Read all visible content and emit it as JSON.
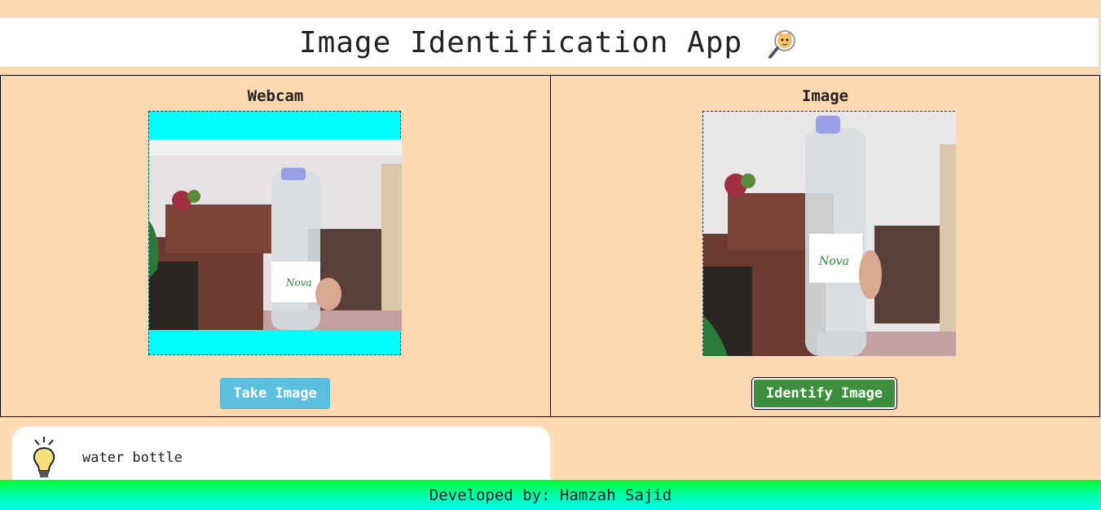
{
  "app": {
    "title": "Image Identification App",
    "title_icon": "cat-magnifying-glass-icon"
  },
  "webcam_panel": {
    "heading": "Webcam",
    "button_label": "Take Image",
    "button_color": "#5bc0de",
    "frame_color": "#00ffff"
  },
  "image_panel": {
    "heading": "Image",
    "button_label": "Identify Image",
    "button_color": "#3c8f3c"
  },
  "result": {
    "icon": "lightbulb-icon",
    "text": "water bottle"
  },
  "footer": {
    "text": "Developed by: Hamzah Sajid"
  },
  "colors": {
    "background": "#fed8b1",
    "header": "#ffffff",
    "footer_gradient_top": "#00ff2a",
    "footer_gradient_bottom": "#00ffee"
  }
}
